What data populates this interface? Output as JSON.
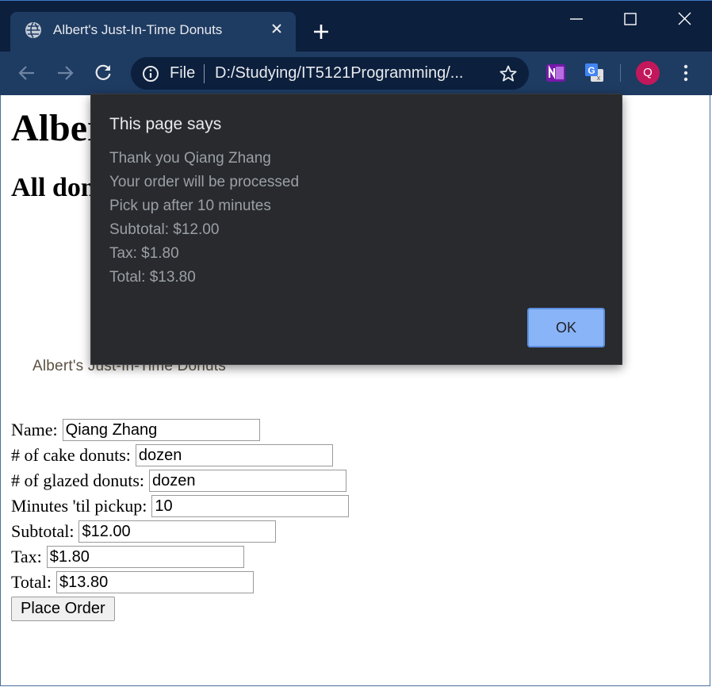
{
  "browser": {
    "tab_title": "Albert's Just-In-Time Donuts",
    "address_scheme": "File",
    "address_url": "D:/Studying/IT5121Programming/...",
    "profile_initial": "Q"
  },
  "page": {
    "heading1": "Albert's Just-In-Time Donuts",
    "heading2": "All donuts",
    "logo_text": "Albert's Just-In-Time Donuts"
  },
  "form": {
    "name_label": "Name:",
    "name_value": "Qiang Zhang",
    "cake_label": "# of cake donuts:",
    "cake_value": "dozen",
    "glazed_label": "# of glazed donuts:",
    "glazed_value": "dozen",
    "minutes_label": "Minutes 'til pickup:",
    "minutes_value": "10",
    "subtotal_label": "Subtotal:",
    "subtotal_value": "$12.00",
    "tax_label": "Tax:",
    "tax_value": "$1.80",
    "total_label": "Total:",
    "total_value": "$13.80",
    "submit_label": "Place Order"
  },
  "dialog": {
    "title": "This page says",
    "lines": [
      "Thank you Qiang Zhang",
      "Your order will be processed",
      "Pick up after 10 minutes",
      "Subtotal: $12.00",
      "Tax: $1.80",
      "Total: $13.80"
    ],
    "ok_label": "OK"
  },
  "colors": {
    "titlebar": "#0c1f3d",
    "toolbar": "#1e3b62",
    "dialog_bg": "#292a2d",
    "ok_button": "#8ab4f8",
    "avatar": "#c2185b"
  },
  "icons": [
    "globe-icon",
    "close-icon",
    "plus-icon",
    "minimize-icon",
    "maximize-icon",
    "window-close-icon",
    "back-icon",
    "forward-icon",
    "reload-icon",
    "info-icon",
    "star-icon",
    "onenote-icon",
    "translate-icon",
    "menu-dots-icon"
  ]
}
